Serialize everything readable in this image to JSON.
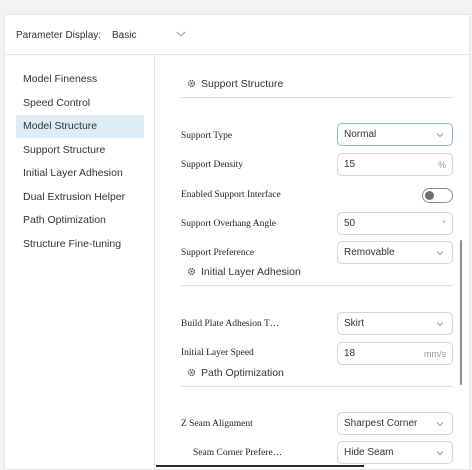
{
  "header": {
    "parameter_display_label": "Parameter Display:",
    "parameter_display_value": "Basic"
  },
  "sidebar": {
    "items": [
      {
        "label": "Model Fineness",
        "active": false
      },
      {
        "label": "Speed Control",
        "active": false
      },
      {
        "label": "Model Structure",
        "active": true
      },
      {
        "label": "Support Structure",
        "active": false
      },
      {
        "label": "Initial Layer Adhesion",
        "active": false
      },
      {
        "label": "Dual Extrusion Helper",
        "active": false
      },
      {
        "label": "Path Optimization",
        "active": false
      },
      {
        "label": "Structure Fine-tuning",
        "active": false
      }
    ]
  },
  "sections": {
    "support": {
      "title": "Support Structure",
      "support_type": {
        "label": "Support Type",
        "value": "Normal"
      },
      "support_density": {
        "label": "Support Density",
        "value": "15",
        "unit": "%"
      },
      "enabled_interface": {
        "label": "Enabled Support Interface",
        "enabled": false
      },
      "overhang_angle": {
        "label": "Support Overhang Angle",
        "value": "50",
        "unit": "°"
      },
      "preference": {
        "label": "Support Preference",
        "value": "Removable"
      }
    },
    "adhesion": {
      "title": "Initial Layer Adhesion",
      "plate_adhesion": {
        "label": "Build Plate Adhesion T…",
        "value": "Skirt"
      },
      "initial_speed": {
        "label": "Initial Layer Speed",
        "value": "18",
        "unit": "mm/s"
      }
    },
    "path": {
      "title": "Path Optimization",
      "z_seam": {
        "label": "Z Seam Alignment",
        "value": "Sharpest Corner"
      },
      "seam_corner": {
        "label": "Seam Corner Prefere…",
        "value": "Hide Seam"
      }
    }
  },
  "colors": {
    "active_item_bg": "#dcedf8",
    "focused_border": "#8fb4d6",
    "toggle_knob": "#6e6e6e"
  },
  "icons": [
    "chevron-down-icon",
    "gear-icon"
  ]
}
